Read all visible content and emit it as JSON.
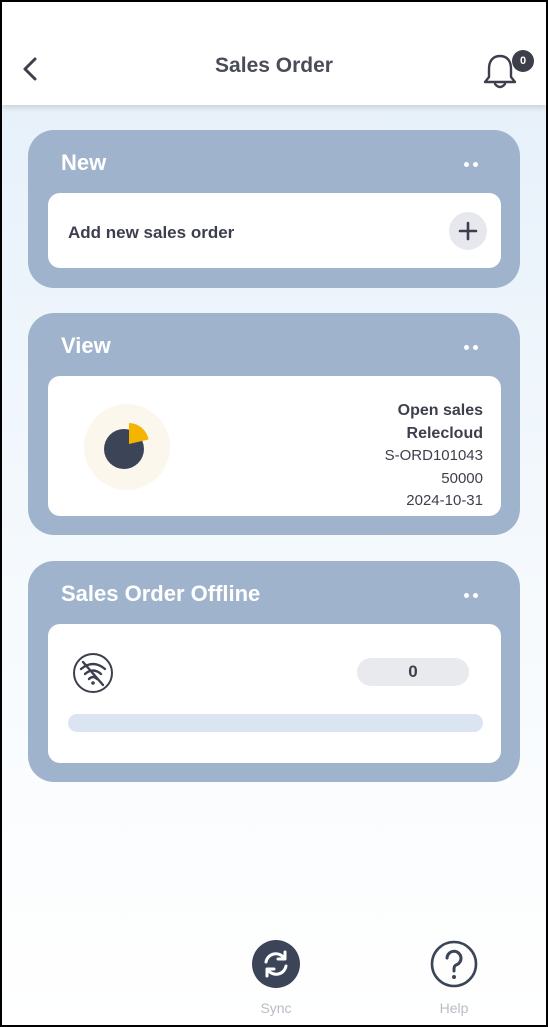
{
  "header": {
    "title": "Sales Order",
    "notification_count": "0"
  },
  "cards": {
    "new": {
      "title": "New",
      "add_label": "Add new sales order"
    },
    "view": {
      "title": "View",
      "order": {
        "status": "Open sales",
        "customer": "Relecloud",
        "number": "S-ORD101043",
        "amount": "50000",
        "date": "2024-10-31"
      }
    },
    "offline": {
      "title": "Sales Order Offline",
      "pending_count": "0",
      "progress": 0
    }
  },
  "nav": {
    "sync_label": "Sync",
    "help_label": "Help"
  },
  "colors": {
    "card": "#9fb4cc",
    "accent": "#f4b400",
    "dark": "#3c3f4a"
  },
  "icons": [
    "back-arrow-icon",
    "bell-icon",
    "more-icon",
    "plus-icon",
    "pie-chart-icon",
    "wifi-off-icon",
    "sync-icon",
    "help-icon"
  ]
}
